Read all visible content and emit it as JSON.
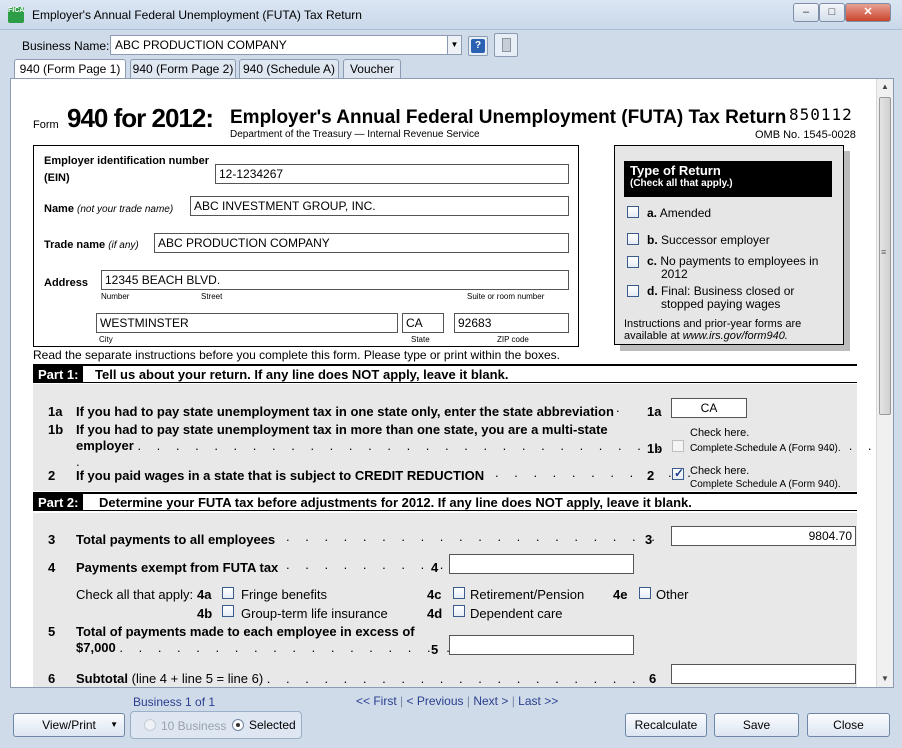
{
  "window": {
    "title": "Employer's Annual Federal Unemployment (FUTA) Tax Return",
    "min": "–",
    "max": "□",
    "close": "✕",
    "app_icon_text": "FICA"
  },
  "toolbar": {
    "business_label": "Business Name:",
    "business_value": "ABC PRODUCTION COMPANY",
    "help_icon": "?"
  },
  "tabs": [
    {
      "label": "940 (Form Page 1)",
      "active": true
    },
    {
      "label": "940 (Form Page 2)",
      "active": false
    },
    {
      "label": "940 (Schedule A)",
      "active": false
    },
    {
      "label": "Voucher",
      "active": false
    }
  ],
  "form": {
    "form_word": "Form",
    "number": "940 for 2012:",
    "title": "Employer's Annual Federal Unemployment (FUTA) Tax Return",
    "dept": "Department of the Treasury — Internal Revenue Service",
    "code": "850112",
    "omb": "OMB No. 1545-0028",
    "ein_label": "Employer identification number",
    "ein_abbr": "(EIN)",
    "ein_value": "12-1234267",
    "name_label": "Name",
    "name_hint": "(not your trade name)",
    "name_value": "ABC INVESTMENT GROUP, INC.",
    "trade_label": "Trade name",
    "trade_hint": "(if any)",
    "trade_value": "ABC PRODUCTION COMPANY",
    "address_label": "Address",
    "street_value": "12345 BEACH BLVD.",
    "number_caption": "Number",
    "street_caption": "Street",
    "suite_caption": "Suite or room number",
    "city_value": "WESTMINSTER",
    "state_value": "CA",
    "zip_value": "92683",
    "city_caption": "City",
    "state_caption": "State",
    "zip_caption": "ZIP code",
    "instructions": "Read the separate instructions before you complete this form. Please type or print within the boxes.",
    "type_of_return": {
      "title": "Type of Return",
      "subtitle": "(Check all that apply.)",
      "a_letter": "a.",
      "a_text": "Amended",
      "b_letter": "b.",
      "b_text": "Successor employer",
      "c_letter": "c.",
      "c_text_1": "No payments to employees in",
      "c_text_2": "2012",
      "d_letter": "d.",
      "d_text_1": "Final: Business closed or",
      "d_text_2": "stopped paying wages",
      "footer_1": "Instructions and prior-year forms are",
      "footer_2": "available at",
      "footer_url": "www.irs.gov/form940."
    },
    "part1": {
      "tag": "Part 1:",
      "text": "Tell us about your return. If any line does NOT apply, leave it blank.",
      "l1a_num": "1a",
      "l1a_text": "If you had to pay state unemployment tax in one state only, enter the state abbreviation",
      "l1a_value": "CA",
      "l1b_num": "1b",
      "l1b_text_1": "If you had to pay state unemployment tax in more than one state, you are a multi-state",
      "l1b_text_2": "employer",
      "check_here": "Check here.",
      "complete_sched": "Complete Schedule A (Form 940).",
      "l2_num": "2",
      "l2_text": "If you paid wages in a state that is subject to CREDIT REDUCTION"
    },
    "part2": {
      "tag": "Part 2:",
      "text": "Determine your FUTA tax before adjustments for 2012. If any line does NOT apply, leave it blank.",
      "l3_num": "3",
      "l3_text": "Total payments to all employees",
      "l3_value": "9804.70",
      "l4_num": "4",
      "l4_text": "Payments exempt from FUTA tax",
      "check_all": "Check all that apply:",
      "c4a": "4a",
      "c4a_text": "Fringe benefits",
      "c4b": "4b",
      "c4b_text": "Group-term life insurance",
      "c4c": "4c",
      "c4c_text": "Retirement/Pension",
      "c4d": "4d",
      "c4d_text": "Dependent care",
      "c4e": "4e",
      "c4e_text": "Other",
      "l5_num": "5",
      "l5_text_1": "Total of payments made to each employee in excess of",
      "l5_text_2": "$7,000",
      "l6_num": "6",
      "l6_bold": "Subtotal",
      "l6_rest": "(line 4 + line 5 = line 6)"
    }
  },
  "footer": {
    "business_count": "Business 1 of 1",
    "first": "<< First",
    "previous": "< Previous",
    "next": "Next >",
    "last": "Last >>",
    "sep": "|",
    "view_print": "View/Print",
    "radio_all": "10 Business",
    "radio_selected": "Selected",
    "recalculate": "Recalculate",
    "save": "Save",
    "close": "Close"
  }
}
